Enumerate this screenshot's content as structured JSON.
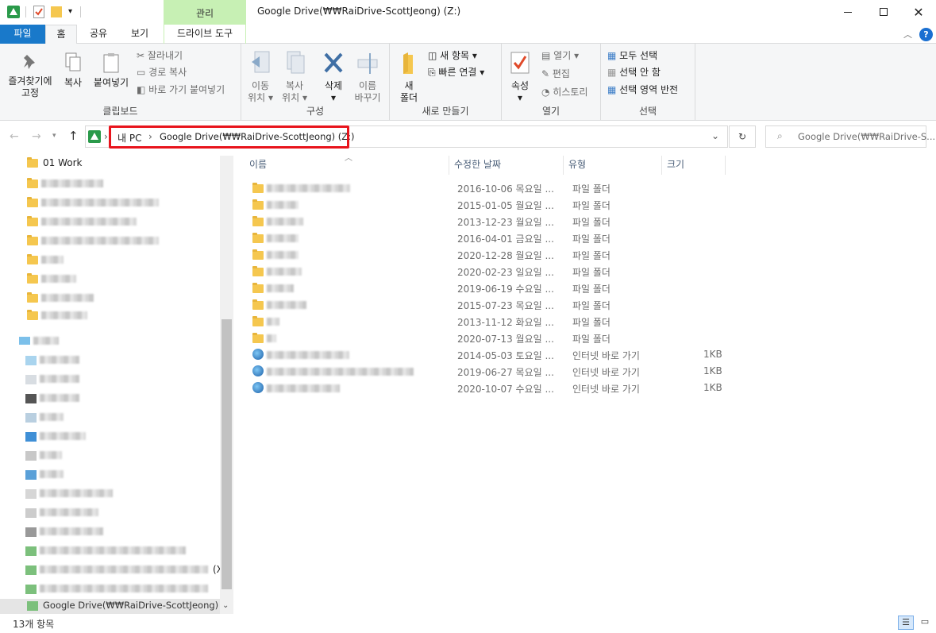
{
  "window": {
    "title": "Google Drive(₩₩RaiDrive-ScottJeong) (Z:)",
    "context_tab": "관리",
    "min_icon": "minimize-icon",
    "max_icon": "maximize-icon",
    "close_icon": "close-icon"
  },
  "tabs": {
    "file": "파일",
    "home": "홈",
    "share": "공유",
    "view": "보기",
    "drive_tools": "드라이브 도구"
  },
  "ribbon": {
    "clipboard": {
      "label": "클립보드",
      "pin": "즐겨찾기에\n고정",
      "pin_line1": "즐겨찾기에",
      "pin_line2": "고정",
      "copy": "복사",
      "paste": "붙여넣기",
      "cut": "잘라내기",
      "copy_path": "경로 복사",
      "paste_shortcut": "바로 가기 붙여넣기"
    },
    "organize": {
      "label": "구성",
      "move_l1": "이동",
      "move_l2": "위치",
      "copyto_l1": "복사",
      "copyto_l2": "위치",
      "delete": "삭제",
      "rename_l1": "이름",
      "rename_l2": "바꾸기"
    },
    "new": {
      "label": "새로 만들기",
      "new_folder_l1": "새",
      "new_folder_l2": "폴더",
      "new_item": "새 항목",
      "easy_access": "빠른 연결"
    },
    "open": {
      "label": "열기",
      "properties": "속성",
      "open": "열기",
      "edit": "편집",
      "history": "히스토리"
    },
    "select": {
      "label": "선택",
      "select_all": "모두 선택",
      "select_none": "선택 안 함",
      "invert": "선택 영역 반전"
    }
  },
  "address": {
    "segments": [
      "내 PC",
      "Google Drive(₩₩RaiDrive-ScottJeong) (Z:)"
    ],
    "separator": "›",
    "search_placeholder": "Google Drive(₩₩RaiDrive-S..."
  },
  "nav": {
    "first_item": "01 Work",
    "bottom_item": "Google Drive(₩₩RaiDrive-ScottJeong) (Z:)",
    "partial_text": "(X"
  },
  "columns": {
    "name": "이름",
    "modified": "수정한 날짜",
    "type": "유형",
    "size": "크기"
  },
  "files": [
    {
      "date": "2016-10-06 목요일 ...",
      "type": "파일 폴더",
      "size": "",
      "kind": "folder"
    },
    {
      "date": "2015-01-05 월요일 ...",
      "type": "파일 폴더",
      "size": "",
      "kind": "folder"
    },
    {
      "date": "2013-12-23 월요일 ...",
      "type": "파일 폴더",
      "size": "",
      "kind": "folder"
    },
    {
      "date": "2016-04-01 금요일 ...",
      "type": "파일 폴더",
      "size": "",
      "kind": "folder"
    },
    {
      "date": "2020-12-28 월요일 ...",
      "type": "파일 폴더",
      "size": "",
      "kind": "folder"
    },
    {
      "date": "2020-02-23 일요일 ...",
      "type": "파일 폴더",
      "size": "",
      "kind": "folder"
    },
    {
      "date": "2019-06-19 수요일 ...",
      "type": "파일 폴더",
      "size": "",
      "kind": "folder"
    },
    {
      "date": "2015-07-23 목요일 ...",
      "type": "파일 폴더",
      "size": "",
      "kind": "folder"
    },
    {
      "date": "2013-11-12 화요일 ...",
      "type": "파일 폴더",
      "size": "",
      "kind": "folder"
    },
    {
      "date": "2020-07-13 월요일 ...",
      "type": "파일 폴더",
      "size": "",
      "kind": "folder"
    },
    {
      "date": "2014-05-03 토요일 ...",
      "type": "인터넷 바로 가기",
      "size": "1KB",
      "kind": "link"
    },
    {
      "date": "2019-06-27 목요일 ...",
      "type": "인터넷 바로 가기",
      "size": "1KB",
      "kind": "link"
    },
    {
      "date": "2020-10-07 수요일 ...",
      "type": "인터넷 바로 가기",
      "size": "1KB",
      "kind": "link"
    }
  ],
  "status": {
    "count": "13개 항목"
  },
  "colors": {
    "file_tab": "#1979ca",
    "context_tab": "#c7f0b4",
    "highlight": "#e8141c"
  }
}
